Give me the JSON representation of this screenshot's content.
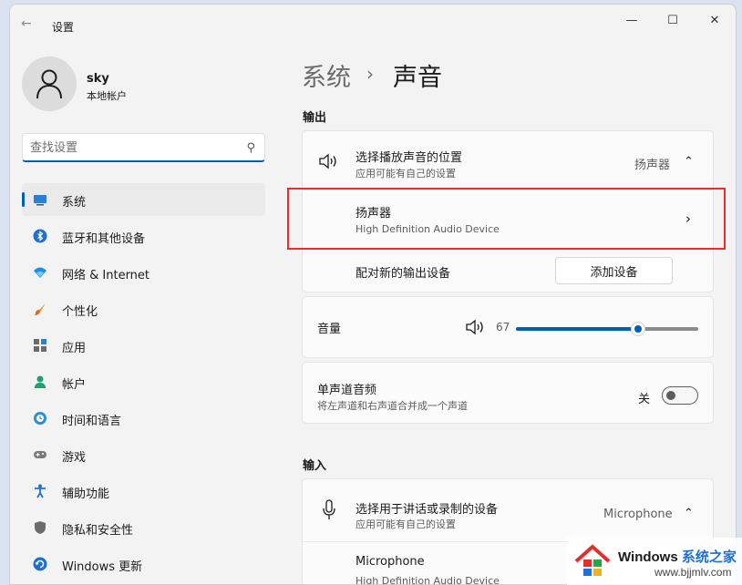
{
  "window": {
    "title": "设置",
    "back_icon": "back-arrow-icon",
    "minimize_icon": "minimize-icon",
    "maximize_icon": "maximize-icon",
    "close_icon": "close-icon"
  },
  "profile": {
    "name": "sky",
    "account_type": "本地帐户"
  },
  "search": {
    "placeholder": "查找设置",
    "icon": "search-icon"
  },
  "sidebar": {
    "items": [
      {
        "label": "系统",
        "icon": "system-monitor-icon",
        "active": true
      },
      {
        "label": "蓝牙和其他设备",
        "icon": "bluetooth-icon"
      },
      {
        "label": "网络 & Internet",
        "icon": "wifi-icon"
      },
      {
        "label": "个性化",
        "icon": "brush-icon"
      },
      {
        "label": "应用",
        "icon": "apps-icon"
      },
      {
        "label": "帐户",
        "icon": "account-icon"
      },
      {
        "label": "时间和语言",
        "icon": "clock-globe-icon"
      },
      {
        "label": "游戏",
        "icon": "gamepad-icon"
      },
      {
        "label": "辅助功能",
        "icon": "accessibility-icon"
      },
      {
        "label": "隐私和安全性",
        "icon": "shield-icon"
      },
      {
        "label": "Windows 更新",
        "icon": "windows-update-icon"
      }
    ]
  },
  "breadcrumb": {
    "parent": "系统",
    "separator": "›",
    "current": "声音"
  },
  "output": {
    "section_title": "输出",
    "choose_title": "选择播放声音的位置",
    "choose_sub": "应用可能有自己的设置",
    "choose_value": "扬声器",
    "device_name": "扬声器",
    "device_desc": "High Definition Audio Device",
    "pair_label": "配对新的输出设备",
    "add_device_button": "添加设备"
  },
  "volume": {
    "label": "音量",
    "value": "67",
    "level": 67
  },
  "mono": {
    "title": "单声道音频",
    "sub": "将左声道和右声道合并成一个声道",
    "state_label": "关",
    "enabled": false
  },
  "input": {
    "section_title": "输入",
    "choose_title": "选择用于讲话或录制的设备",
    "choose_sub": "应用可能有自己的设置",
    "choose_value": "Microphone",
    "device_name": "Microphone",
    "device_desc": "High Definition Audio Device"
  },
  "watermark": {
    "title_main": "Windows",
    "title_accent": "系统之家",
    "url": "www.bjjmlv.com"
  },
  "colors": {
    "accent": "#005fb8",
    "highlight_box": "#e0302e"
  }
}
